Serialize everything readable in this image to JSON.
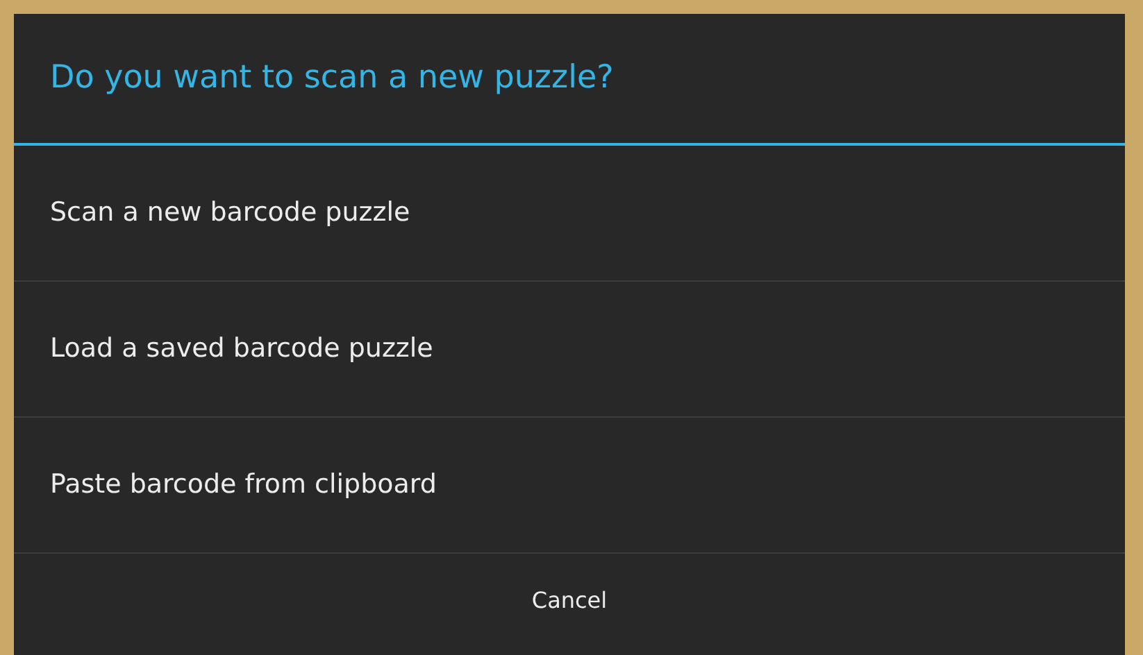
{
  "dialog": {
    "title": "Do you want to scan a new puzzle?",
    "options": [
      "Scan a new barcode puzzle",
      "Load a saved barcode puzzle",
      "Paste barcode from clipboard"
    ],
    "buttons": [
      "Cancel"
    ]
  }
}
